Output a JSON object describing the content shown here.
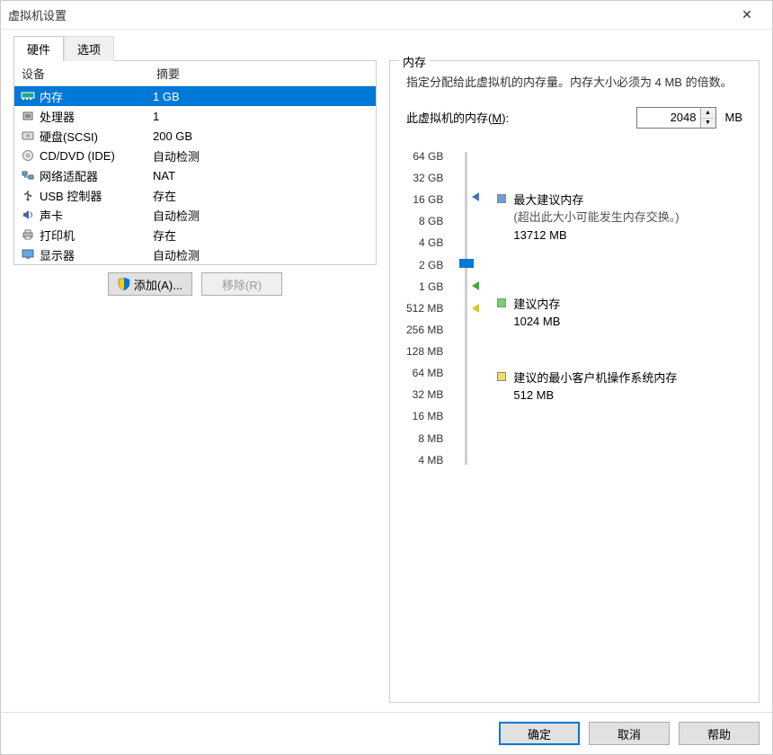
{
  "window": {
    "title": "虚拟机设置"
  },
  "tabs": {
    "hardware": "硬件",
    "options": "选项",
    "active": "hardware"
  },
  "list": {
    "header_device": "设备",
    "header_summary": "摘要",
    "items": [
      {
        "icon": "memory-icon",
        "name": "内存",
        "summary": "1 GB",
        "selected": true
      },
      {
        "icon": "cpu-icon",
        "name": "处理器",
        "summary": "1"
      },
      {
        "icon": "disk-icon",
        "name": "硬盘(SCSI)",
        "summary": "200 GB"
      },
      {
        "icon": "cd-icon",
        "name": "CD/DVD (IDE)",
        "summary": "自动检测"
      },
      {
        "icon": "network-icon",
        "name": "网络适配器",
        "summary": "NAT"
      },
      {
        "icon": "usb-icon",
        "name": "USB 控制器",
        "summary": "存在"
      },
      {
        "icon": "sound-icon",
        "name": "声卡",
        "summary": "自动检测"
      },
      {
        "icon": "printer-icon",
        "name": "打印机",
        "summary": "存在"
      },
      {
        "icon": "display-icon",
        "name": "显示器",
        "summary": "自动检测"
      }
    ]
  },
  "buttons": {
    "add": "添加(A)...",
    "remove": "移除(R)"
  },
  "memory": {
    "group": "内存",
    "desc": "指定分配给此虚拟机的内存量。内存大小必须为 4 MB 的倍数。",
    "label_prefix": "此虚拟机的内存(",
    "label_hotkey": "M",
    "label_suffix": "):",
    "value": "2048",
    "unit": "MB",
    "ticks": [
      "64 GB",
      "32 GB",
      "16 GB",
      "8 GB",
      "4 GB",
      "2 GB",
      "1 GB",
      "512 MB",
      "256 MB",
      "128 MB",
      "64 MB",
      "32 MB",
      "16 MB",
      "8 MB",
      "4 MB"
    ],
    "legend": {
      "max_title": "最大建议内存",
      "max_sub": "(超出此大小可能发生内存交换。)",
      "max_val": "13712 MB",
      "rec_title": "建议内存",
      "rec_val": "1024 MB",
      "min_title": "建议的最小客户机操作系统内存",
      "min_val": "512 MB"
    }
  },
  "footer": {
    "ok": "确定",
    "cancel": "取消",
    "help": "帮助"
  }
}
